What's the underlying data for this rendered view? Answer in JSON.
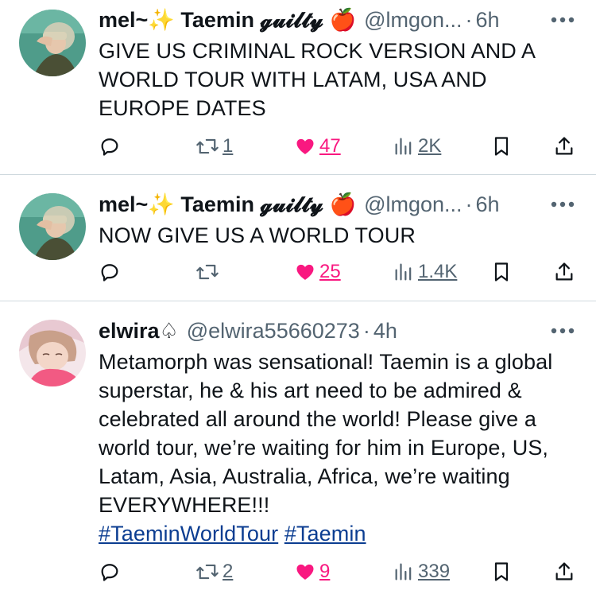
{
  "tweets": [
    {
      "display_name": "mel~✨ Taemin 𝓰𝓾𝓲𝓵𝓽𝔂 🍎",
      "handle": "@lmgon...",
      "time": "6h",
      "text": "GIVE US CRIMINAL ROCK VERSION AND A WORLD TOUR WITH LATAM, USA AND EUROPE DATES",
      "retweets": "1",
      "likes": "47",
      "views": "2K"
    },
    {
      "display_name": "mel~✨ Taemin 𝓰𝓾𝓲𝓵𝓽𝔂 🍎",
      "handle": "@lmgon...",
      "time": "6h",
      "text": "NOW GIVE US A WORLD TOUR",
      "retweets": "",
      "likes": "25",
      "views": "1.4K"
    },
    {
      "display_name": "elwira♤",
      "handle": "@elwira55660273",
      "time": "4h",
      "text": "Metamorph was sensational! Taemin is a global superstar, he & his art need to be admired & celebrated all around the world! Please give a world tour, we’re waiting for him in Europe, US, Latam, Asia, Australia, Africa, we’re waiting EVERYWHERE!!!",
      "hashtags": [
        "#TaeminWorldTour",
        "#Taemin"
      ],
      "retweets": "2",
      "likes": "9",
      "views": "339"
    }
  ],
  "separator": "·",
  "icons": {
    "reply": "reply-icon",
    "retweet": "retweet-icon",
    "like": "heart-filled-icon",
    "views": "views-icon",
    "bookmark": "bookmark-icon",
    "share": "share-icon",
    "more": "more-icon"
  },
  "colors": {
    "text": "#0f1419",
    "secondary": "#536471",
    "like": "#f91880",
    "hashtag": "#0b3d91",
    "divider": "#cfd9de"
  }
}
